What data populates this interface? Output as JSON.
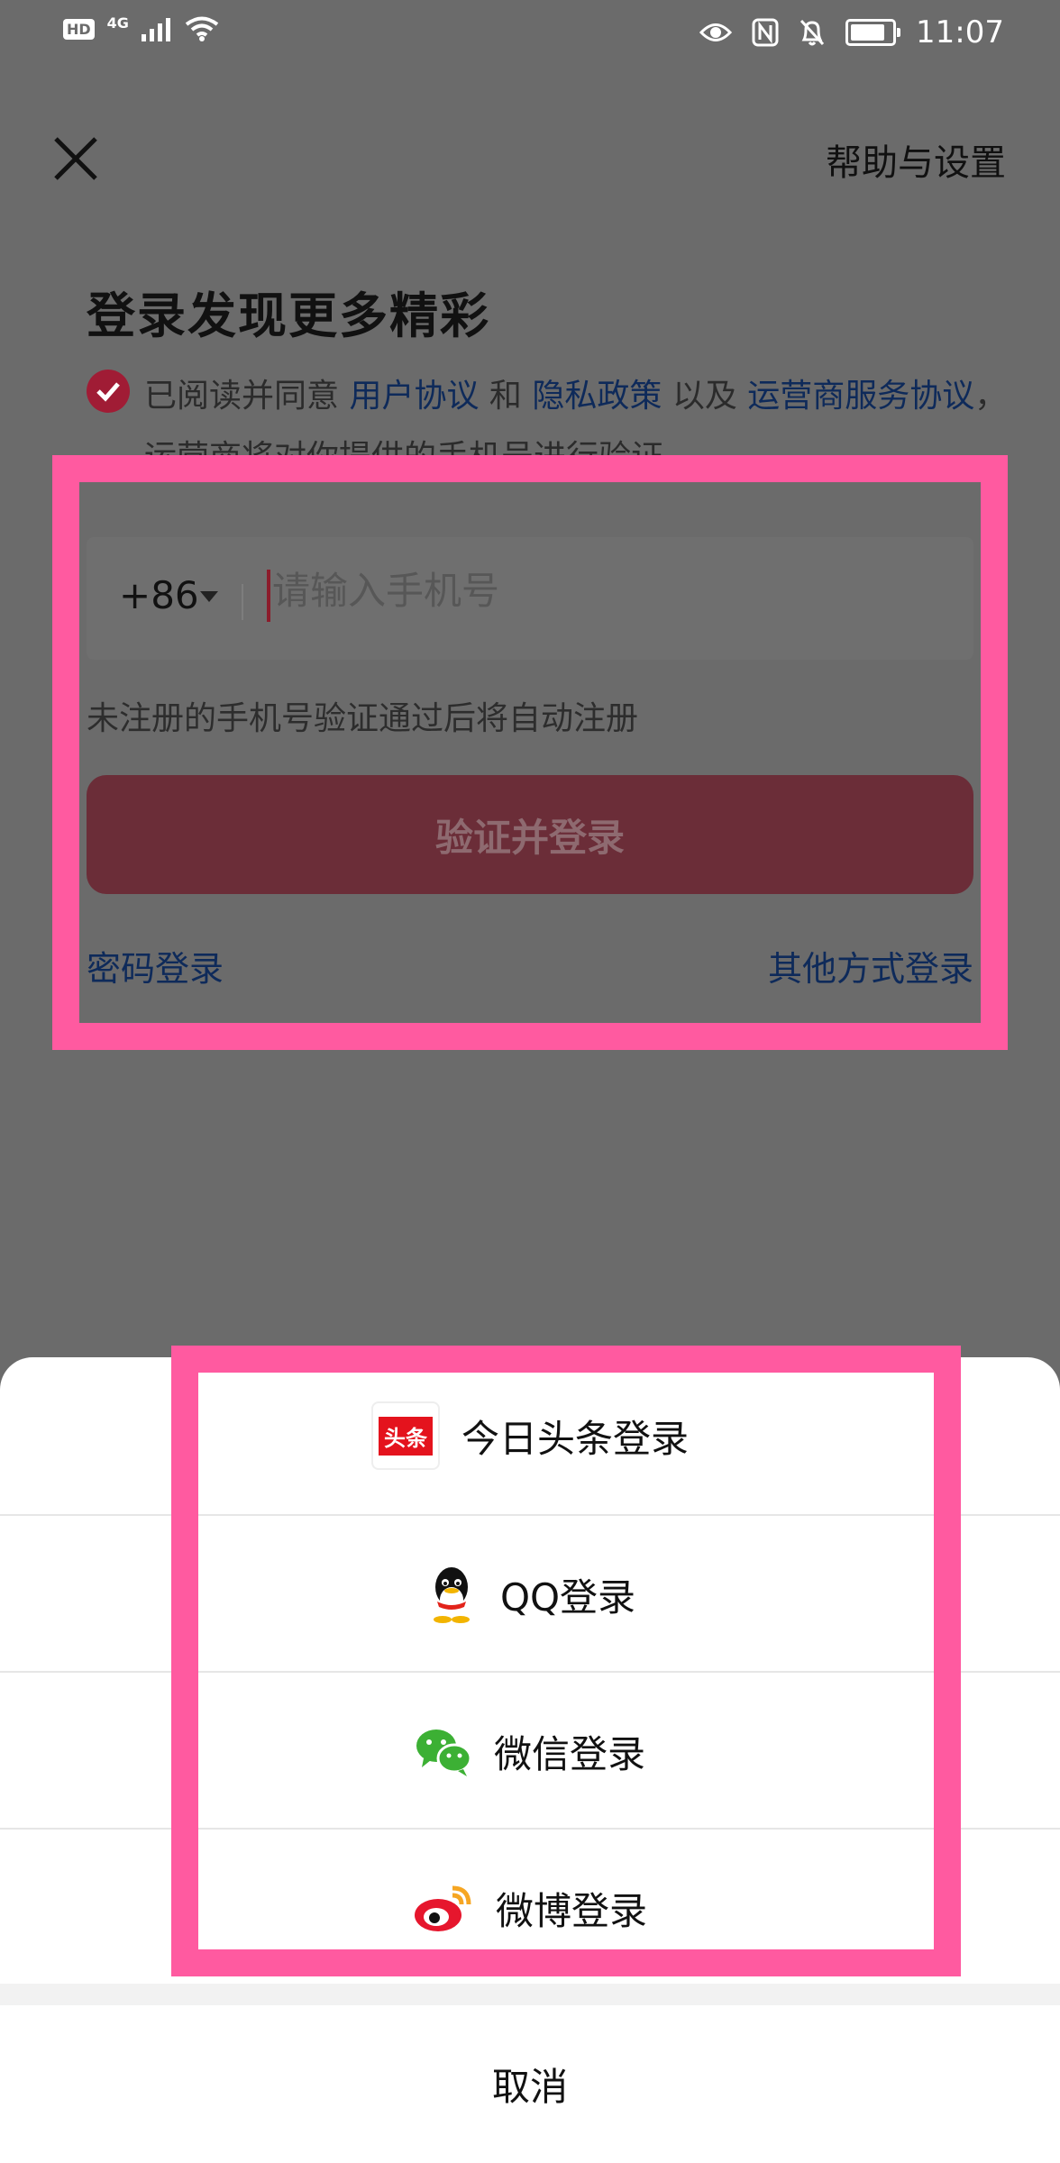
{
  "status_bar": {
    "left_badge": "HD",
    "network": "4G",
    "time": "11:07",
    "battery_level": 0.85,
    "icons": [
      "signal-icon",
      "wifi-icon",
      "eye-icon",
      "nfc-icon",
      "bell-off-icon",
      "battery-icon"
    ]
  },
  "header": {
    "close_icon": "close-icon",
    "help": "帮助与设置"
  },
  "title": "登录发现更多精彩",
  "agreement": {
    "checked": true,
    "t1": "已阅读并同意 ",
    "l1": "用户协议",
    "t2": " 和 ",
    "l2": "隐私政策",
    "t3": " 以及 ",
    "l3": "运营商服务协议",
    "t4": "，运营商将对你提供的手机号进行验证"
  },
  "form": {
    "country_code": "+86",
    "phone_placeholder": "请输入手机号",
    "hint": "未注册的手机号验证通过后将自动注册",
    "submit": "验证并登录",
    "password_login": "密码登录",
    "other_login": "其他方式登录"
  },
  "sheet": {
    "options": [
      {
        "label": "今日头条登录",
        "icon": "toutiao-icon",
        "icon_text": "头条"
      },
      {
        "label": "QQ登录",
        "icon": "qq-icon"
      },
      {
        "label": "微信登录",
        "icon": "wechat-icon"
      },
      {
        "label": "微博登录",
        "icon": "weibo-icon"
      }
    ],
    "cancel": "取消"
  },
  "colors": {
    "overlay": "#6b6b6b",
    "accent": "#a01c35",
    "link": "#0e2a5a",
    "highlight": "#ff5aa0"
  }
}
